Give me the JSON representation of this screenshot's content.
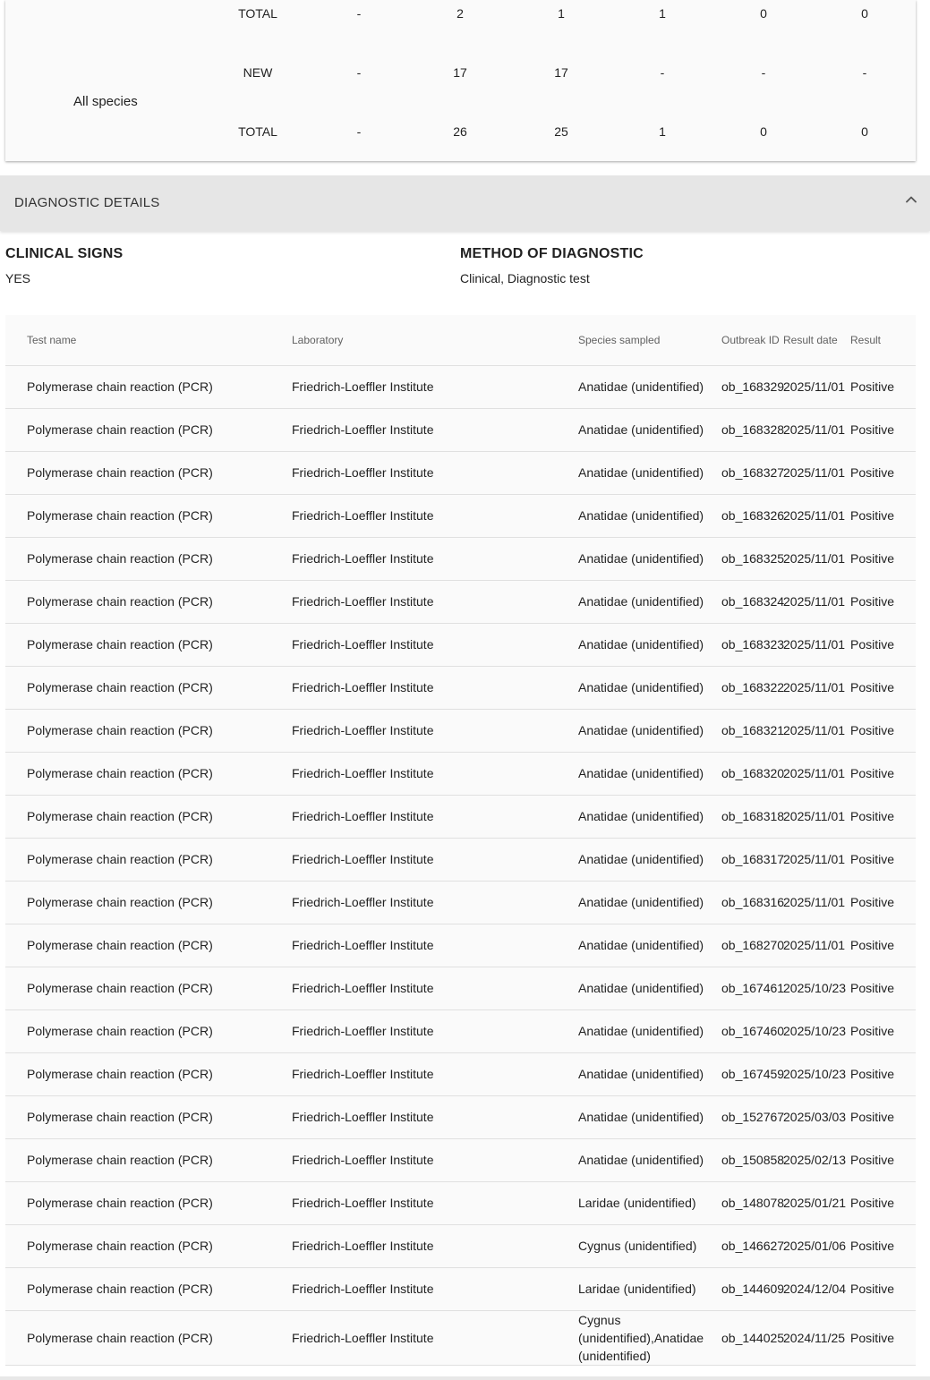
{
  "summary": {
    "species_label": "All species",
    "rows": [
      {
        "type": "TOTAL",
        "c1": "-",
        "c2": "2",
        "c3": "1",
        "c4": "1",
        "c5": "0",
        "c6": "0"
      },
      {
        "type": "NEW",
        "c1": "-",
        "c2": "17",
        "c3": "17",
        "c4": "-",
        "c5": "-",
        "c6": "-"
      },
      {
        "type": "TOTAL",
        "c1": "-",
        "c2": "26",
        "c3": "25",
        "c4": "1",
        "c5": "0",
        "c6": "0"
      }
    ]
  },
  "section": {
    "title": "DIAGNOSTIC DETAILS",
    "toggle_icon": "chevron-up-icon"
  },
  "clinical_signs": {
    "label": "CLINICAL SIGNS",
    "value": "YES"
  },
  "method": {
    "label": "METHOD OF DIAGNOSTIC",
    "value": "Clinical, Diagnostic test"
  },
  "tests": {
    "headers": [
      "Test name",
      "Laboratory",
      "Species sampled",
      "Outbreak ID",
      "Result date",
      "Result"
    ],
    "rows": [
      {
        "test": "Polymerase chain reaction (PCR)",
        "lab": "Friedrich-Loeffler Institute",
        "species": "Anatidae (unidentified)",
        "outbreak": "ob_168329",
        "date": "2025/11/01",
        "result": "Positive"
      },
      {
        "test": "Polymerase chain reaction (PCR)",
        "lab": "Friedrich-Loeffler Institute",
        "species": "Anatidae (unidentified)",
        "outbreak": "ob_168328",
        "date": "2025/11/01",
        "result": "Positive"
      },
      {
        "test": "Polymerase chain reaction (PCR)",
        "lab": "Friedrich-Loeffler Institute",
        "species": "Anatidae (unidentified)",
        "outbreak": "ob_168327",
        "date": "2025/11/01",
        "result": "Positive"
      },
      {
        "test": "Polymerase chain reaction (PCR)",
        "lab": "Friedrich-Loeffler Institute",
        "species": "Anatidae (unidentified)",
        "outbreak": "ob_168326",
        "date": "2025/11/01",
        "result": "Positive"
      },
      {
        "test": "Polymerase chain reaction (PCR)",
        "lab": "Friedrich-Loeffler Institute",
        "species": "Anatidae (unidentified)",
        "outbreak": "ob_168325",
        "date": "2025/11/01",
        "result": "Positive"
      },
      {
        "test": "Polymerase chain reaction (PCR)",
        "lab": "Friedrich-Loeffler Institute",
        "species": "Anatidae (unidentified)",
        "outbreak": "ob_168324",
        "date": "2025/11/01",
        "result": "Positive"
      },
      {
        "test": "Polymerase chain reaction (PCR)",
        "lab": "Friedrich-Loeffler Institute",
        "species": "Anatidae (unidentified)",
        "outbreak": "ob_168323",
        "date": "2025/11/01",
        "result": "Positive"
      },
      {
        "test": "Polymerase chain reaction (PCR)",
        "lab": "Friedrich-Loeffler Institute",
        "species": "Anatidae (unidentified)",
        "outbreak": "ob_168322",
        "date": "2025/11/01",
        "result": "Positive"
      },
      {
        "test": "Polymerase chain reaction (PCR)",
        "lab": "Friedrich-Loeffler Institute",
        "species": "Anatidae (unidentified)",
        "outbreak": "ob_168321",
        "date": "2025/11/01",
        "result": "Positive"
      },
      {
        "test": "Polymerase chain reaction (PCR)",
        "lab": "Friedrich-Loeffler Institute",
        "species": "Anatidae (unidentified)",
        "outbreak": "ob_168320",
        "date": "2025/11/01",
        "result": "Positive"
      },
      {
        "test": "Polymerase chain reaction (PCR)",
        "lab": "Friedrich-Loeffler Institute",
        "species": "Anatidae (unidentified)",
        "outbreak": "ob_168318",
        "date": "2025/11/01",
        "result": "Positive"
      },
      {
        "test": "Polymerase chain reaction (PCR)",
        "lab": "Friedrich-Loeffler Institute",
        "species": "Anatidae (unidentified)",
        "outbreak": "ob_168317",
        "date": "2025/11/01",
        "result": "Positive"
      },
      {
        "test": "Polymerase chain reaction (PCR)",
        "lab": "Friedrich-Loeffler Institute",
        "species": "Anatidae (unidentified)",
        "outbreak": "ob_168316",
        "date": "2025/11/01",
        "result": "Positive"
      },
      {
        "test": "Polymerase chain reaction (PCR)",
        "lab": "Friedrich-Loeffler Institute",
        "species": "Anatidae (unidentified)",
        "outbreak": "ob_168270",
        "date": "2025/11/01",
        "result": "Positive"
      },
      {
        "test": "Polymerase chain reaction (PCR)",
        "lab": "Friedrich-Loeffler Institute",
        "species": "Anatidae (unidentified)",
        "outbreak": "ob_167461",
        "date": "2025/10/23",
        "result": "Positive"
      },
      {
        "test": "Polymerase chain reaction (PCR)",
        "lab": "Friedrich-Loeffler Institute",
        "species": "Anatidae (unidentified)",
        "outbreak": "ob_167460",
        "date": "2025/10/23",
        "result": "Positive"
      },
      {
        "test": "Polymerase chain reaction (PCR)",
        "lab": "Friedrich-Loeffler Institute",
        "species": "Anatidae (unidentified)",
        "outbreak": "ob_167459",
        "date": "2025/10/23",
        "result": "Positive"
      },
      {
        "test": "Polymerase chain reaction (PCR)",
        "lab": "Friedrich-Loeffler Institute",
        "species": "Anatidae (unidentified)",
        "outbreak": "ob_152767",
        "date": "2025/03/03",
        "result": "Positive"
      },
      {
        "test": "Polymerase chain reaction (PCR)",
        "lab": "Friedrich-Loeffler Institute",
        "species": "Anatidae (unidentified)",
        "outbreak": "ob_150858",
        "date": "2025/02/13",
        "result": "Positive"
      },
      {
        "test": "Polymerase chain reaction (PCR)",
        "lab": "Friedrich-Loeffler Institute",
        "species": "Laridae (unidentified)",
        "outbreak": "ob_148078",
        "date": "2025/01/21",
        "result": "Positive"
      },
      {
        "test": "Polymerase chain reaction (PCR)",
        "lab": "Friedrich-Loeffler Institute",
        "species": "Cygnus (unidentified)",
        "outbreak": "ob_146627",
        "date": "2025/01/06",
        "result": "Positive"
      },
      {
        "test": "Polymerase chain reaction (PCR)",
        "lab": "Friedrich-Loeffler Institute",
        "species": "Laridae (unidentified)",
        "outbreak": "ob_144609",
        "date": "2024/12/04",
        "result": "Positive"
      },
      {
        "test": "Polymerase chain reaction (PCR)",
        "lab": "Friedrich-Loeffler Institute",
        "species": "Cygnus (unidentified),Anatidae (unidentified)",
        "outbreak": "ob_144025",
        "date": "2024/11/25",
        "result": "Positive"
      }
    ]
  }
}
